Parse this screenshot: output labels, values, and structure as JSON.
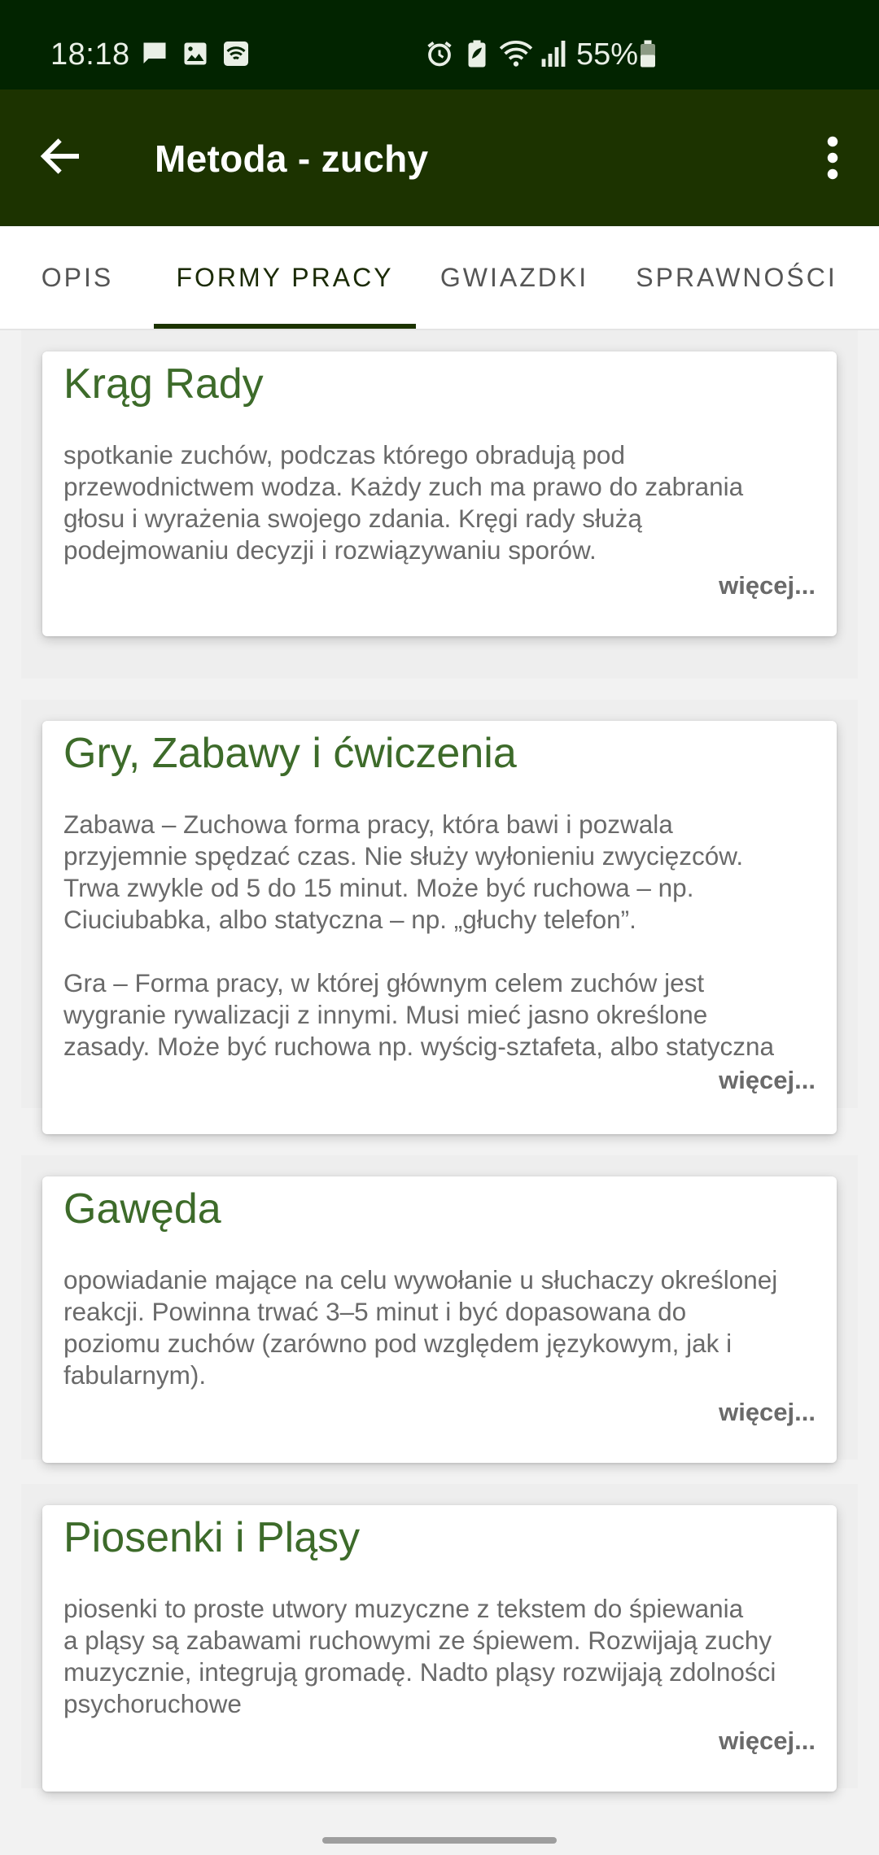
{
  "status_bar": {
    "time": "18:18",
    "battery": "55%",
    "icons": [
      "chat-icon",
      "image-icon",
      "wifi-calling-icon",
      "alarm-icon",
      "battery-saver-icon",
      "wifi-icon",
      "signal-icon",
      "battery-icon"
    ]
  },
  "app_bar": {
    "title": "Metoda - zuchy",
    "back_icon": "arrow-left-icon",
    "menu_icon": "more-vert-icon"
  },
  "tabs": [
    {
      "label": "OPIS",
      "active": false
    },
    {
      "label": "FORMY PRACY",
      "active": true
    },
    {
      "label": "GWIAZDKI",
      "active": false
    },
    {
      "label": "SPRAWNOŚCI",
      "active": false
    }
  ],
  "cards": [
    {
      "title": "Krąg Rady",
      "text": "spotkanie zuchów, podczas którego obradują pod\nprzewodnictwem wodza. Każdy zuch ma prawo do zabrania\ngłosu i wyrażenia swojego zdania. Kręgi rady służą\npodejmowaniu decyzji i rozwiązywaniu sporów.",
      "more": "więcej..."
    },
    {
      "title": "Gry, Zabawy i ćwiczenia",
      "text": "Zabawa – Zuchowa forma pracy, która bawi i pozwala\nprzyjemnie spędzać czas. Nie służy wyłonieniu zwycięzców.\nTrwa zwykle od 5 do 15 minut. Może być ruchowa – np.\nCiuciubabka, albo statyczna – np. „głuchy telefon”.\n\nGra – Forma pracy, w której głównym celem zuchów jest\nwygranie rywalizacji z innymi. Musi mieć jasno określone\nzasady. Może być ruchowa np. wyścig-sztafeta, albo statyczna",
      "more": "więcej..."
    },
    {
      "title": "Gawęda",
      "text": "opowiadanie mające na celu wywołanie u słuchaczy określonej\nreakcji. Powinna trwać 3–5 minut i być dopasowana do\npoziomu zuchów (zarówno pod względem językowym, jak i\nfabularnym).",
      "more": "więcej..."
    },
    {
      "title": "Piosenki i Pląsy",
      "text": "piosenki to proste utwory muzyczne z tekstem do śpiewania\na pląsy są zabawami ruchowymi ze śpiewem. Rozwijają zuchy\nmuzycznie, integrują gromadę. Nadto pląsy rozwijają zdolności\npsychoruchowe",
      "more": "więcej..."
    }
  ],
  "colors": {
    "status_bar": "#022400",
    "app_bar": "#1c3300",
    "card_title": "#3d6b2a",
    "body_text": "#6a6a6a"
  }
}
